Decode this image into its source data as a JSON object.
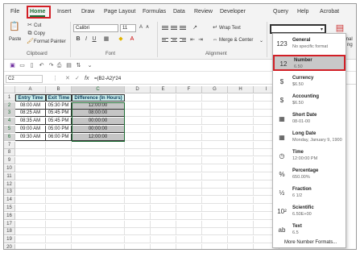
{
  "tabs": [
    "File",
    "Home",
    "Insert",
    "Draw",
    "Page Layout",
    "Formulas",
    "Data",
    "Review",
    "Developer",
    "Query",
    "Help",
    "Acrobat"
  ],
  "ribbon": {
    "clipboard": {
      "paste": "Paste",
      "cut": "Cut",
      "copy": "Copy",
      "format_painter": "Format Painter",
      "label": "Clipboard"
    },
    "font": {
      "name": "Calibri",
      "size": "11",
      "label": "Font"
    },
    "alignment": {
      "wrap_text": "Wrap Text",
      "merge_center": "Merge & Center",
      "label": "Alignment"
    },
    "right_partial": "ional\nng"
  },
  "formula_bar": {
    "name_box": "C2",
    "formula": "=(B2-A2)*24",
    "fx": "fx"
  },
  "grid": {
    "columns": [
      "A",
      "B",
      "C",
      "D",
      "E",
      "F",
      "G",
      "H",
      "I"
    ],
    "rows": [
      "1",
      "2",
      "3",
      "4",
      "5",
      "6",
      "7",
      "8",
      "9",
      "10",
      "11",
      "12",
      "13",
      "14",
      "15",
      "16",
      "17",
      "18",
      "19",
      "20"
    ],
    "headers": [
      "Entry Time",
      "Exit Time",
      "Difference (In Hours)"
    ],
    "data": [
      [
        "08:00 AM",
        "05:30 PM",
        "12:00:00"
      ],
      [
        "08:25 AM",
        "05:45 PM",
        "08:00:00"
      ],
      [
        "08:35 AM",
        "05:45 PM",
        "00:00:00"
      ],
      [
        "09:00 AM",
        "05:00 PM",
        "00:00:00"
      ],
      [
        "09:30 AM",
        "06:00 PM",
        "12:00:00"
      ]
    ]
  },
  "number_format_menu": {
    "items": [
      {
        "icon": "123",
        "name": "General",
        "sample": "No specific format"
      },
      {
        "icon": "12",
        "name": "Number",
        "sample": "6.50"
      },
      {
        "icon": "$",
        "name": "Currency",
        "sample": "$6.50"
      },
      {
        "icon": "$",
        "name": "Accounting",
        "sample": " $6.50"
      },
      {
        "icon": "▦",
        "name": "Short Date",
        "sample": "08-01-00"
      },
      {
        "icon": "▦",
        "name": "Long Date",
        "sample": "Monday, January 9, 1900"
      },
      {
        "icon": "◷",
        "name": "Time",
        "sample": "12:00:00 PM"
      },
      {
        "icon": "%",
        "name": "Percentage",
        "sample": "650.00%"
      },
      {
        "icon": "½",
        "name": "Fraction",
        "sample": "6 1/2"
      },
      {
        "icon": "10²",
        "name": "Scientific",
        "sample": "6.50E+00"
      },
      {
        "icon": "ab",
        "name": "Text",
        "sample": "6.5"
      }
    ],
    "more": "More Number Formats..."
  },
  "colors": {
    "accent": "#1f6e35",
    "highlight": "#d21f26",
    "header_fill": "#ccf0ee"
  }
}
